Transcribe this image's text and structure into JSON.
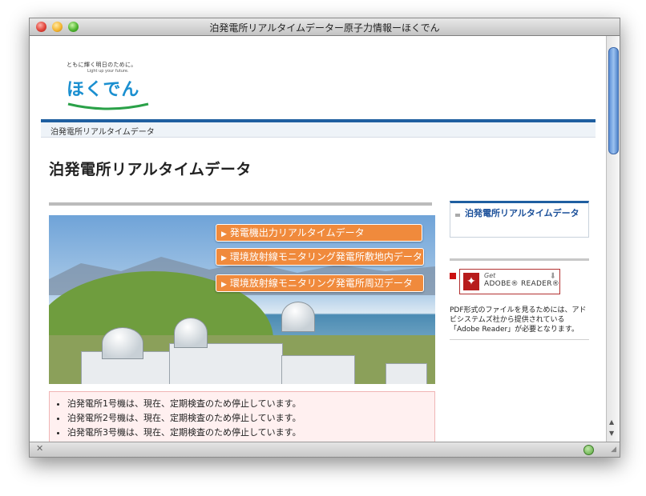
{
  "window": {
    "title": "泊発電所リアルタイムデーター原子力情報ーほくでん"
  },
  "logo": {
    "tagline": "ともに輝く明日のために。",
    "subline": "Light up your future.",
    "mark": "ほくでん"
  },
  "breadcrumb": "泊発電所リアルタイムデータ",
  "page_title": "泊発電所リアルタイムデータ",
  "hero_buttons": [
    {
      "label": "発電機出力リアルタイムデータ"
    },
    {
      "label": "環境放射線モニタリング発電所敷地内データ"
    },
    {
      "label": "環境放射線モニタリング発電所周辺データ"
    }
  ],
  "notices": [
    "泊発電所1号機は、現在、定期検査のため停止しています。",
    "泊発電所2号機は、現在、定期検査のため停止しています。",
    "泊発電所3号機は、現在、定期検査のため停止しています。"
  ],
  "sidebar": {
    "nav_item": "泊発電所リアルタイムデータ",
    "adobe": {
      "get": "Get",
      "reader": "ADOBE® READER®",
      "text": "PDF形式のファイルを見るためには、アドビシステムズ社から提供されている「Adobe Reader」が必要となります。"
    }
  }
}
